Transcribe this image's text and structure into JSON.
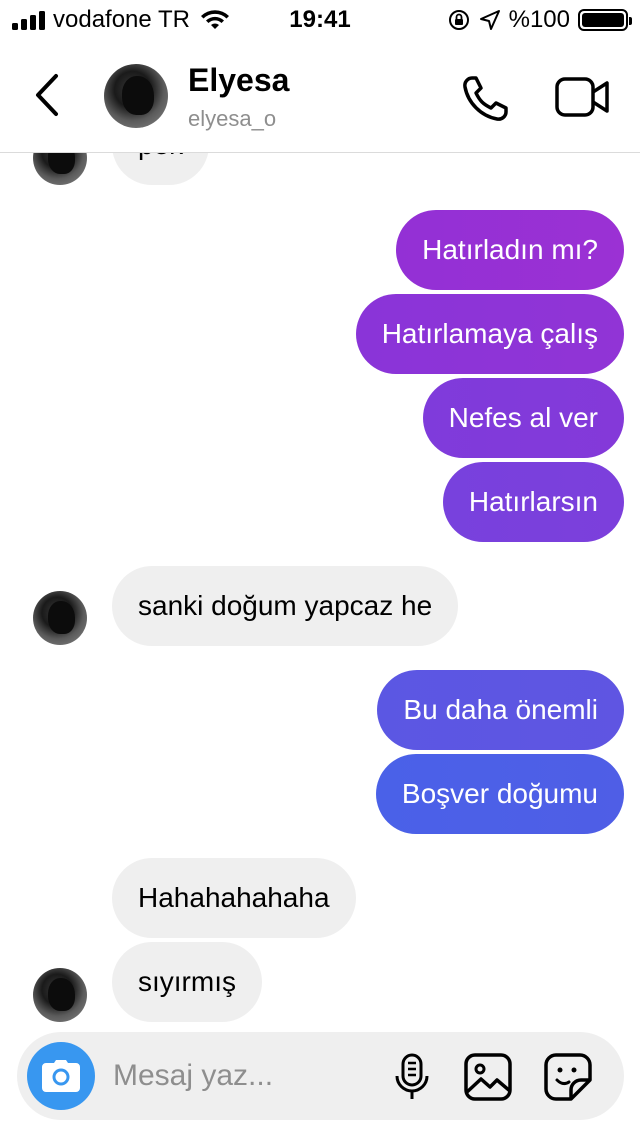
{
  "status_bar": {
    "carrier": "vodafone TR",
    "time": "19:41",
    "battery": "%100"
  },
  "header": {
    "name": "Elyesa",
    "username": "elyesa_o"
  },
  "messages": [
    {
      "dir": "in",
      "text": "pek"
    },
    {
      "dir": "out",
      "text": "Hatırladın mı?"
    },
    {
      "dir": "out",
      "text": "Hatırlamaya çalış"
    },
    {
      "dir": "out",
      "text": "Nefes al ver"
    },
    {
      "dir": "out",
      "text": "Hatırlarsın"
    },
    {
      "dir": "in",
      "text": "sanki doğum yapcaz he"
    },
    {
      "dir": "out",
      "text": "Bu daha önemli"
    },
    {
      "dir": "out",
      "text": "Boşver doğumu"
    },
    {
      "dir": "in",
      "text": "Hahahahahaha"
    },
    {
      "dir": "in",
      "text": "sıyırmış"
    }
  ],
  "composer": {
    "placeholder": "Mesaj yaz..."
  },
  "icons": {
    "back": "chevron-left-icon",
    "call": "phone-icon",
    "video": "video-camera-icon",
    "camera": "camera-icon",
    "mic": "microphone-icon",
    "gallery": "image-icon",
    "sticker": "sticker-icon"
  },
  "colors": {
    "bubble_in": "#efefef",
    "outgoing_top": "#9b2fd6",
    "outgoing_bottom": "#3d64ea",
    "camera_button": "#3897f0"
  }
}
